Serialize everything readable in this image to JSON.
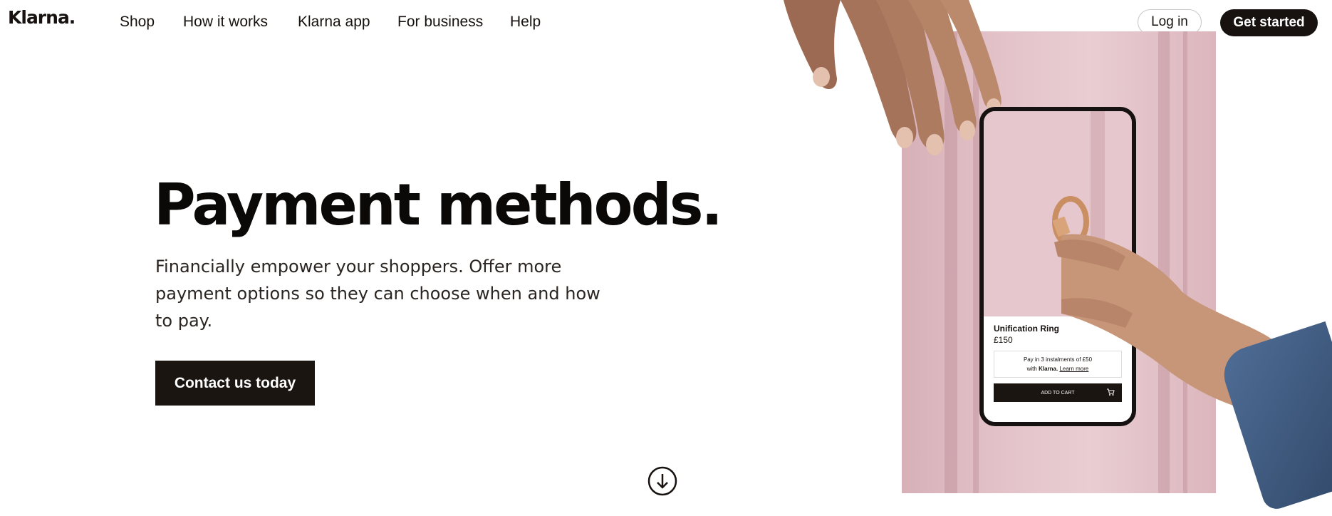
{
  "brand": {
    "logo_text": "Klarna."
  },
  "nav": {
    "links": [
      "Shop",
      "How it works",
      "Klarna app",
      "For business",
      "Help"
    ],
    "login_label": "Log in",
    "get_started_label": "Get started"
  },
  "hero": {
    "title": "Payment methods.",
    "subtitle": "Financially empower your shoppers. Offer more payment options so they can choose when and how to pay.",
    "cta_label": "Contact us today"
  },
  "product_card": {
    "name": "Unification Ring",
    "price": "£150",
    "installment_text": "Pay in 3 instalments of £50",
    "installment_with": "with",
    "installment_brand": "Klarna.",
    "learn_more": "Learn more",
    "add_to_cart": "ADD TO CART"
  },
  "colors": {
    "primary_dark": "#17120f",
    "panel_pink": "#e4c4ca",
    "sleeve_blue": "#3f5a80"
  },
  "icons": {
    "scroll": "arrow-down-circle-icon",
    "cart": "shopping-cart-icon"
  }
}
